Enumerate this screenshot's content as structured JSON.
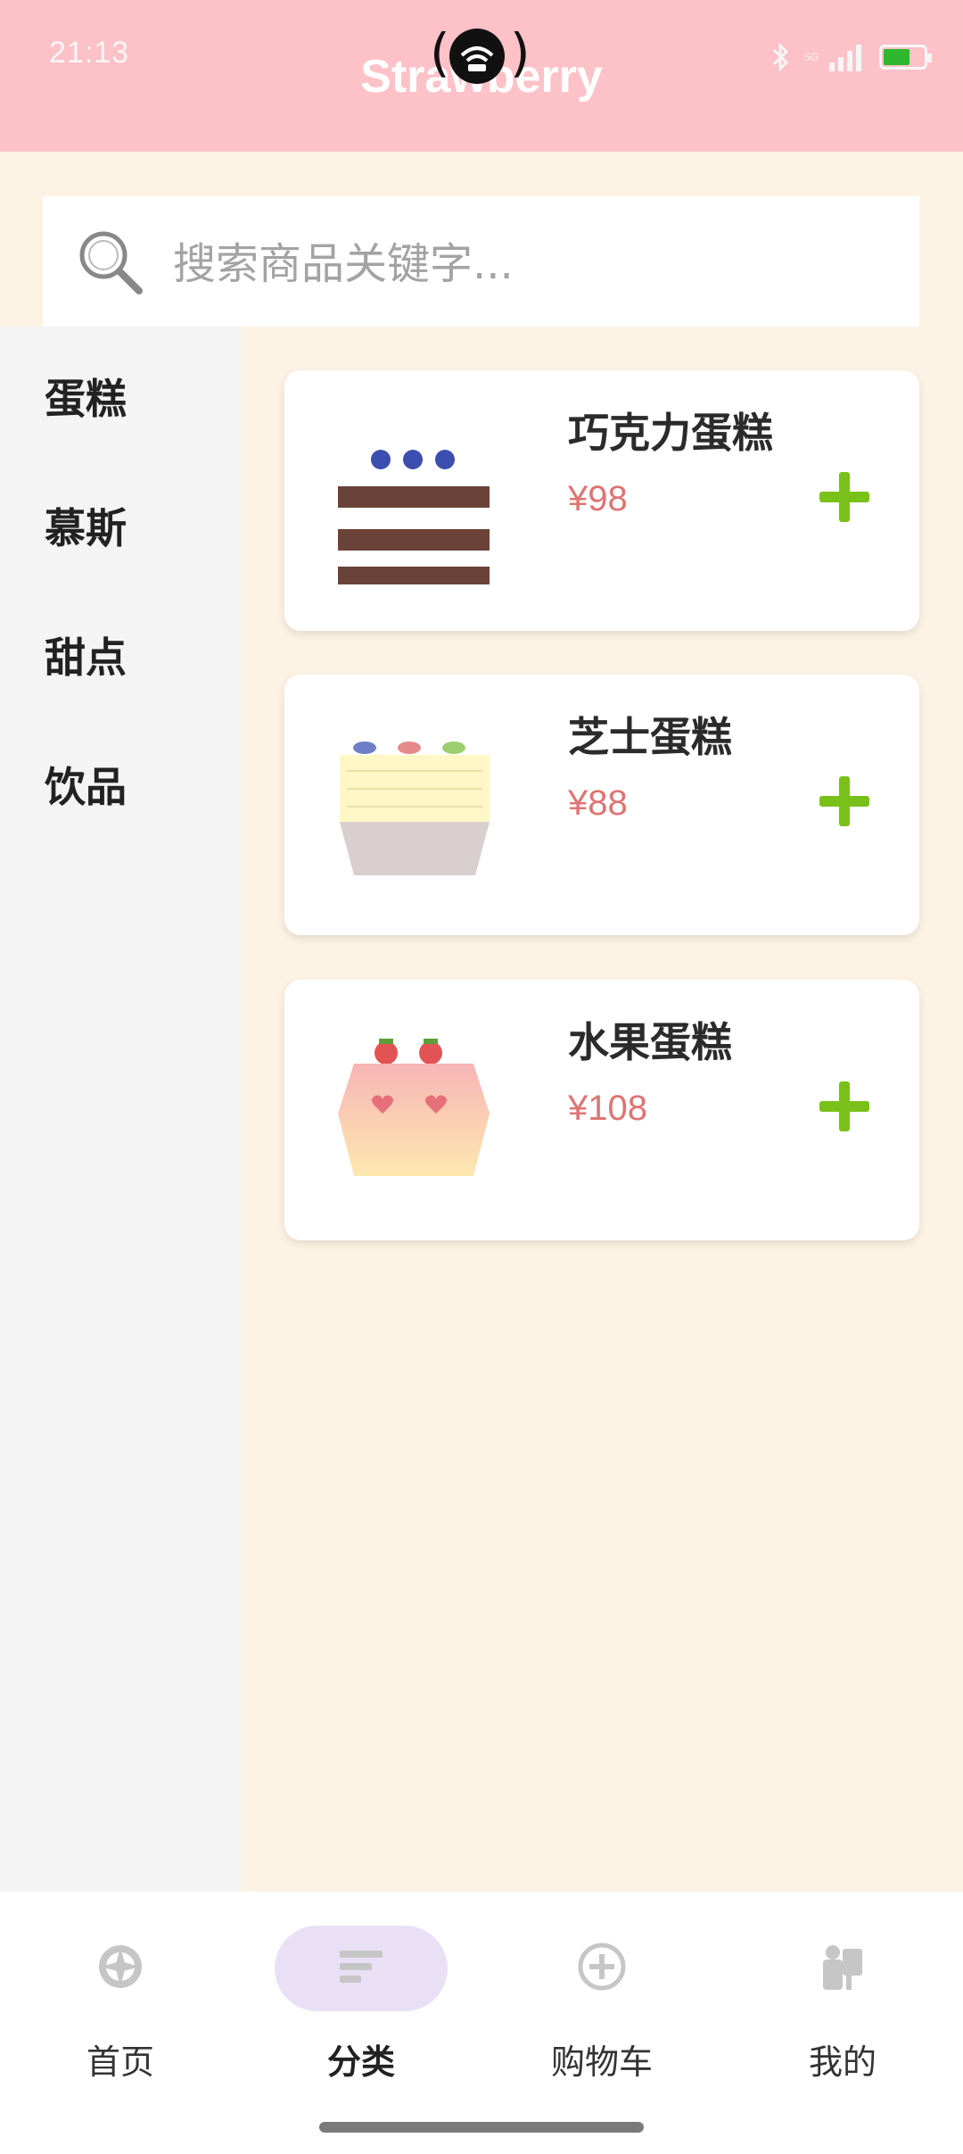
{
  "status_bar": {
    "time": "21:13",
    "network": "5G"
  },
  "app": {
    "title": "Strawberry"
  },
  "search": {
    "placeholder": "搜索商品关键字..."
  },
  "sidebar": {
    "items": [
      {
        "label": "蛋糕"
      },
      {
        "label": "慕斯"
      },
      {
        "label": "甜点"
      },
      {
        "label": "饮品"
      }
    ]
  },
  "products": [
    {
      "name": "巧克力蛋糕",
      "price": "¥98",
      "icon": "chocolate-cake-icon"
    },
    {
      "name": "芝士蛋糕",
      "price": "¥88",
      "icon": "cheese-cake-icon"
    },
    {
      "name": "水果蛋糕",
      "price": "¥108",
      "icon": "fruit-cake-icon"
    }
  ],
  "tabbar": {
    "tabs": [
      {
        "label": "首页",
        "icon": "compass-icon"
      },
      {
        "label": "分类",
        "icon": "category-list-icon",
        "active": true
      },
      {
        "label": "购物车",
        "icon": "plus-circle-icon"
      },
      {
        "label": "我的",
        "icon": "user-icon"
      }
    ]
  },
  "colors": {
    "header": "#fdc1c8",
    "background": "#fdf3e4",
    "price": "#e07373",
    "add": "#7ac01a",
    "active_tab": "#e9e0f6"
  }
}
